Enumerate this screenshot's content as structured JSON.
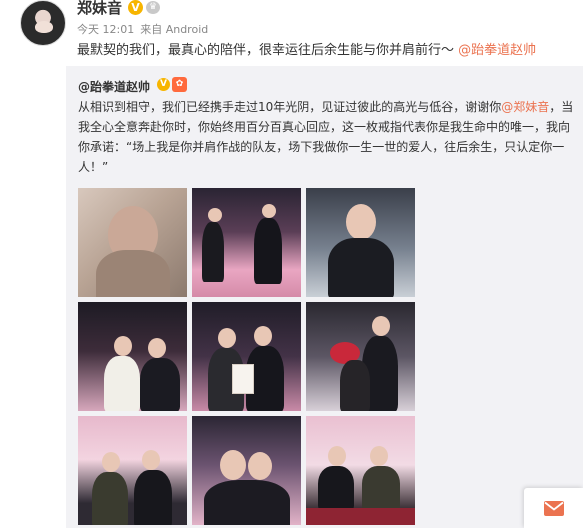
{
  "post": {
    "username": "郑妹音",
    "verified_mark": "V",
    "badge_mark": "♛",
    "time": "今天 12:01",
    "source": "来自 Android",
    "text": "最默契的我们，最真心的陪伴，很幸运往后余生能与你并肩前行～",
    "mention": "@跆拳道赵帅"
  },
  "repost": {
    "author": "@跆拳道赵帅",
    "verified_mark": "V",
    "badge_mark": "✿",
    "text_before": "从相识到相守，我们已经携手走过10年光阴，见证过彼此的高光与低谷，谢谢你",
    "mention": "@郑妹音",
    "text_after": "，当我全心全意奔赴你时，你始终用百分百真心回应，这一枚戒指代表你是我生命中的唯一，我向你承诺：“场上我是你并肩作战的队友，场下我做你一生一世的爱人，往后余生，只认定你一人！”"
  },
  "photos": [
    "photo-1",
    "photo-2",
    "photo-3",
    "photo-4",
    "photo-5",
    "photo-6",
    "photo-7",
    "photo-8",
    "photo-9"
  ],
  "colors": {
    "accent_link": "#eb7350",
    "verified_gold": "#f7b500",
    "repost_bg": "#f2f2f5",
    "mail_orange": "#eb7350"
  },
  "icons": {
    "mail": "mail-icon"
  }
}
